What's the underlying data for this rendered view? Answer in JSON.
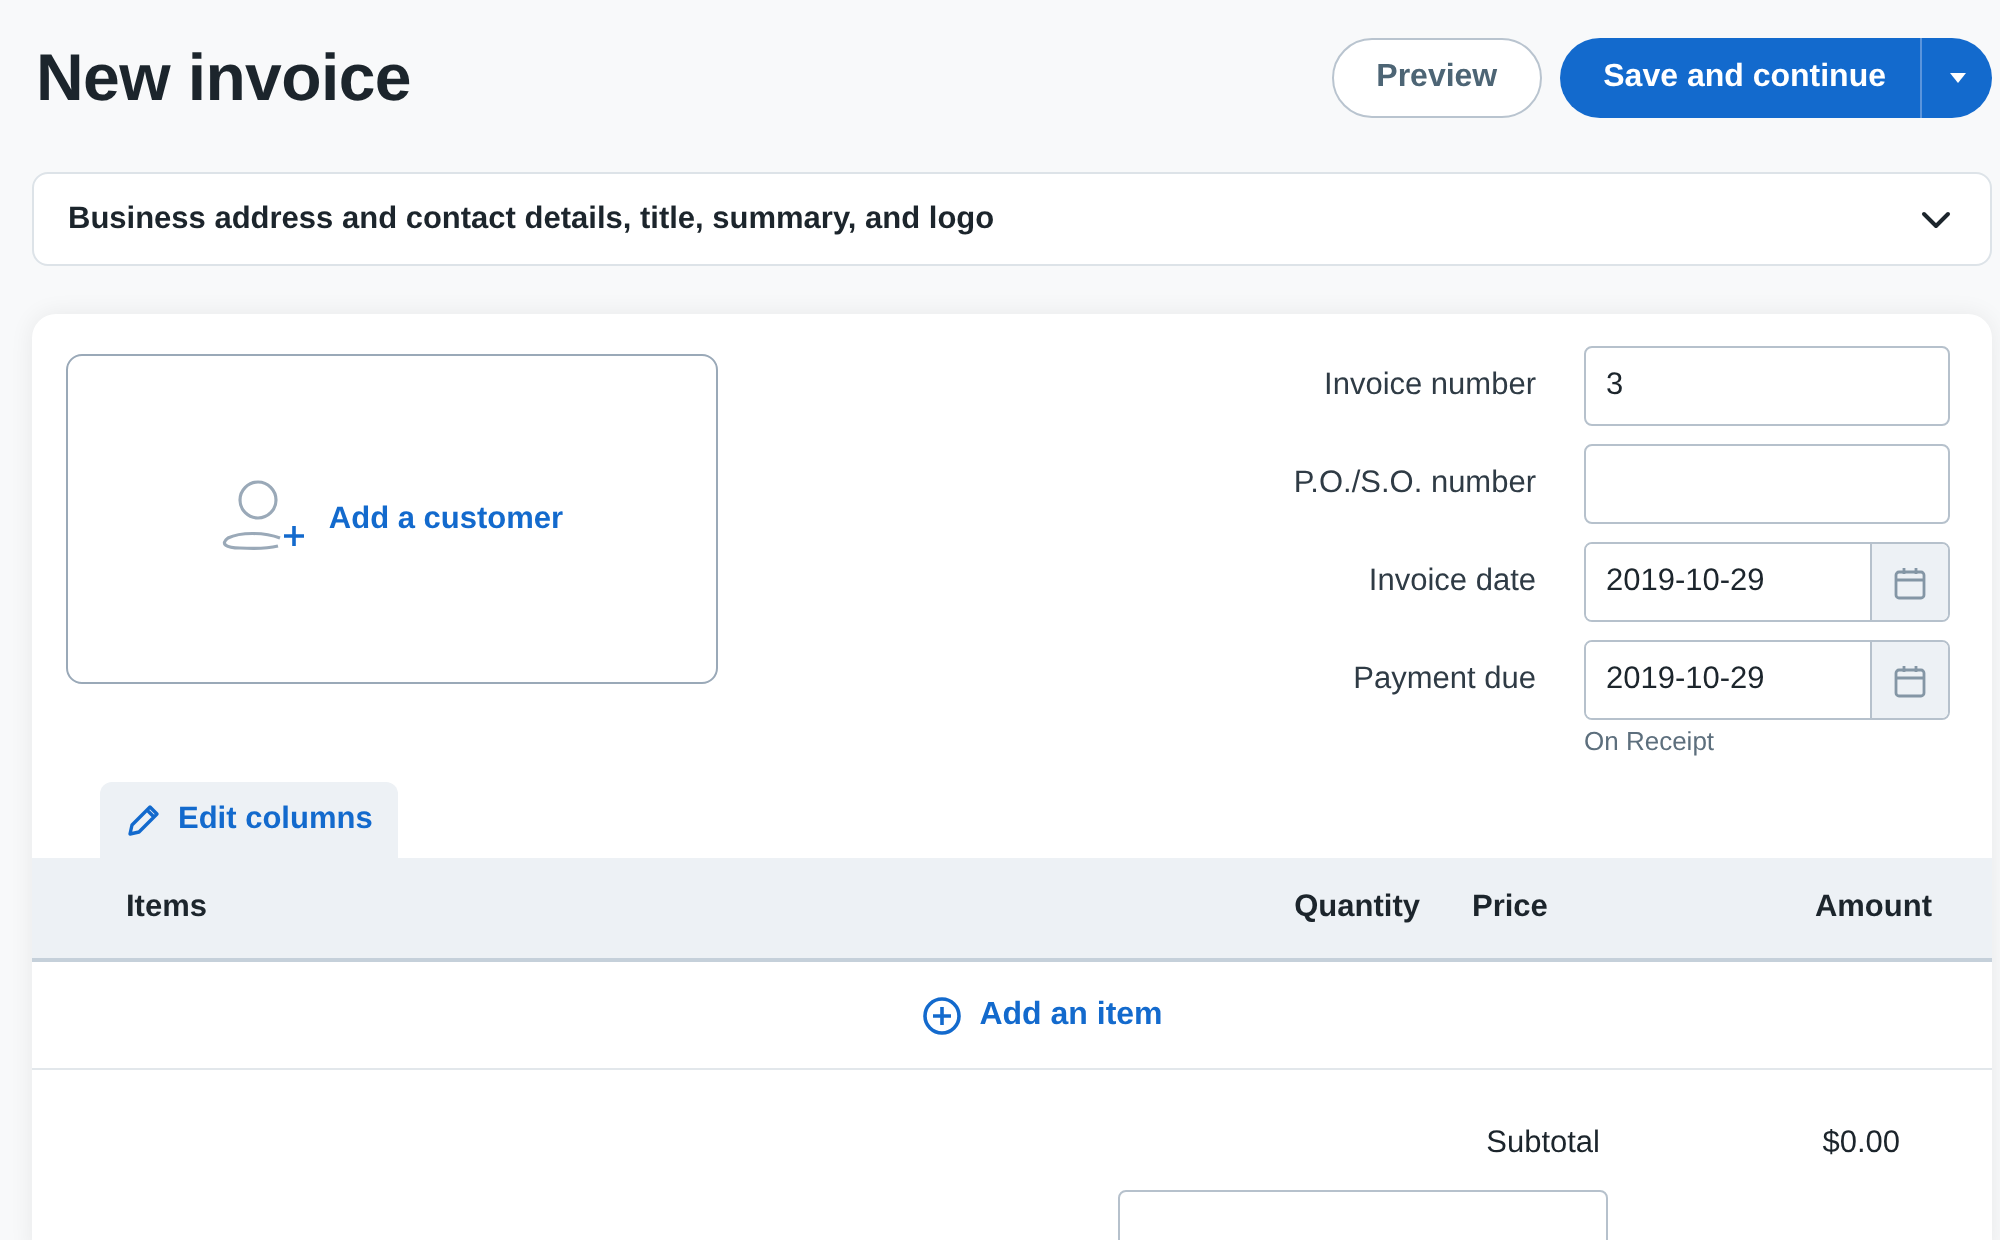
{
  "header": {
    "title": "New invoice",
    "buttons": [
      {
        "label": "Preview",
        "kind": "secondary"
      },
      {
        "label": "Save and continue",
        "kind": "primary"
      }
    ]
  },
  "details_section": {
    "title": "Business address and contact details, title, summary, and logo",
    "expanded": false
  },
  "customer": {
    "label": "Add a customer"
  },
  "fields": [
    {
      "label": "Invoice number",
      "value": "3",
      "kind": "text"
    },
    {
      "label": "P.O./S.O. number",
      "kind": "text"
    },
    {
      "label": "Invoice date",
      "value": "2019-10-29",
      "kind": "date"
    },
    {
      "label": "Payment due",
      "value": "2019-10-29",
      "kind": "date",
      "hint": "On Receipt"
    }
  ],
  "edit_columns": {
    "label": "Edit columns"
  },
  "table": {
    "columns": [
      "Items",
      "Quantity",
      "Price",
      "Amount"
    ]
  },
  "add_item": {
    "label": "Add an item"
  },
  "totals": [
    {
      "label": "Subtotal",
      "value": "$0.00"
    }
  ]
}
